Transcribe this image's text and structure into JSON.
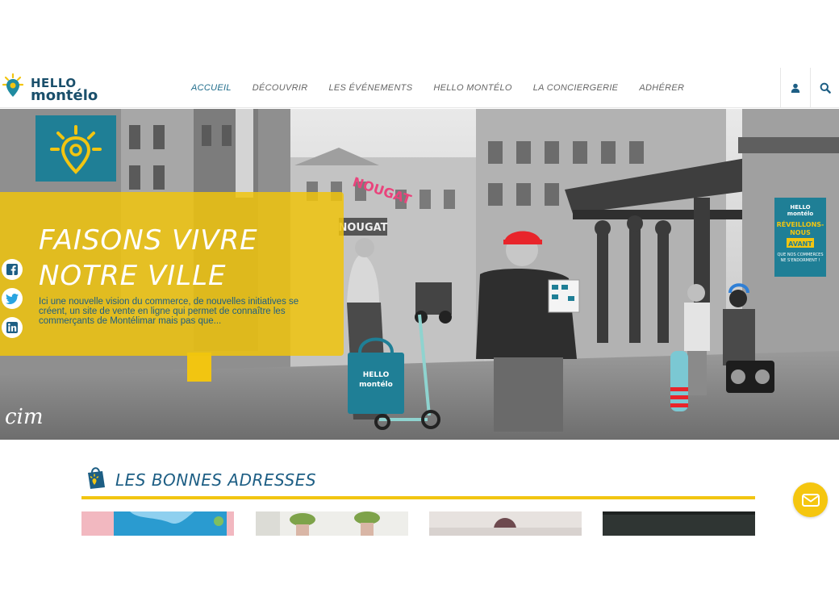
{
  "brand": {
    "line1": "HELLO",
    "line2": "montélo"
  },
  "nav": {
    "items": [
      {
        "label": "ACCUEIL",
        "active": true
      },
      {
        "label": "DÉCOUVRIR",
        "active": false
      },
      {
        "label": "LES ÉVÉNEMENTS",
        "active": false
      },
      {
        "label": "HELLO MONTÉLO",
        "active": false
      },
      {
        "label": "LA CONCIERGERIE",
        "active": false
      },
      {
        "label": "ADHÉRER",
        "active": false
      }
    ]
  },
  "hero": {
    "title_line1": "FAISONS VIVRE",
    "title_line2": "NOTRE VILLE",
    "description": "Ici une nouvelle vision du commerce, de nouvelles initiatives se créent, un site de vente en ligne qui permet de connaître les commerçants de Montélimar mais pas que...",
    "signature": "cim",
    "sign_nougat": "NOUGAT",
    "shop_sign": "NOUGAT",
    "poster_line1": "HELLO",
    "poster_line2": "montélo",
    "poster_line3": "RÉVEILLONS-",
    "poster_line4": "NOUS",
    "poster_line5": "AVANT",
    "poster_line6": "QUE NOS COMMERCES",
    "poster_line7": "NE S'ENDORMENT !",
    "bag_line1": "HELLO",
    "bag_line2": "montélo"
  },
  "section": {
    "title": "LES BONNES ADRESSES"
  },
  "colors": {
    "primary_blue": "#1d5e84",
    "yellow": "#f2c511",
    "teal": "#1f8ba0"
  }
}
